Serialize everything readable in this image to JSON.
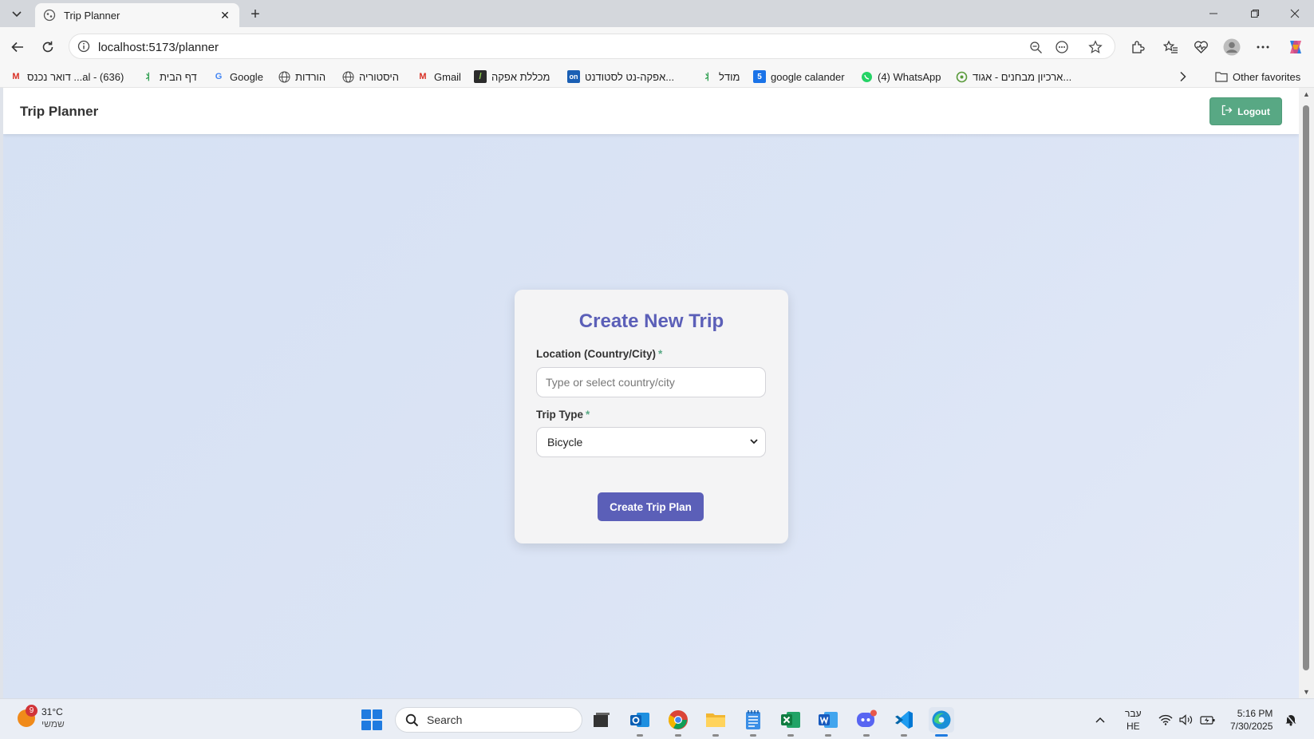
{
  "browser": {
    "tab_title": "Trip Planner",
    "url": "localhost:5173/planner",
    "bookmarks": [
      "(636) - al... דואר נכנס",
      "דף הבית",
      "Google",
      "הורדות",
      "היסטוריה",
      "Gmail",
      "מכללת אפקה",
      "אפקה-נט לסטודנט...",
      "מודל",
      "google calander",
      "(4) WhatsApp",
      "ארכיון מבחנים - אגוד..."
    ],
    "other_favorites": "Other favorites"
  },
  "app": {
    "title": "Trip Planner",
    "logout_label": "Logout"
  },
  "form": {
    "heading": "Create New Trip",
    "location_label": "Location (Country/City)",
    "location_required": "*",
    "location_placeholder": "Type or select country/city",
    "location_value": "",
    "trip_type_label": "Trip Type",
    "trip_type_required": "*",
    "trip_type_value": "Bicycle",
    "submit_label": "Create Trip Plan"
  },
  "colors": {
    "accent": "#5b5fb8",
    "logout_green": "#58a884",
    "page_background": "#d6e1f3"
  },
  "taskbar": {
    "weather_temp": "31°C",
    "weather_desc": "שמשי",
    "weather_badge": "9",
    "search_label": "Search",
    "language_top": "עבר",
    "language_bottom": "HE",
    "time": "5:16 PM",
    "date": "7/30/2025",
    "apps": [
      "file-explorer-stack-icon",
      "outlook-icon",
      "chrome-icon",
      "folder-icon",
      "notepad-icon",
      "excel-icon",
      "word-icon",
      "discord-icon",
      "vscode-icon",
      "edge-icon"
    ]
  }
}
